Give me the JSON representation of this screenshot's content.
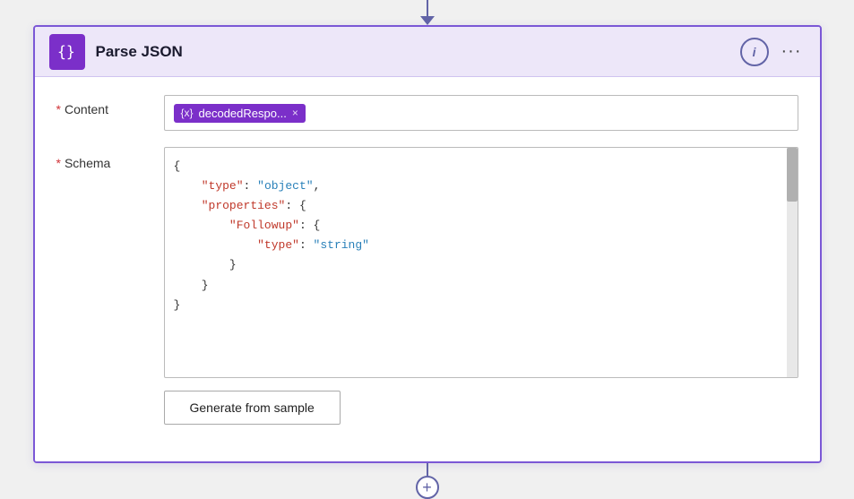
{
  "connector": {
    "top_line_height": "18px",
    "bottom_line_height": "14px"
  },
  "card": {
    "title": "Parse JSON",
    "header_bg": "#ede7f9",
    "border_color": "#7b57d6",
    "icon_name": "braces-icon"
  },
  "info_button": {
    "label": "i"
  },
  "more_button": {
    "label": "···"
  },
  "form": {
    "content_label": "Content",
    "schema_label": "Schema",
    "required_star": "*"
  },
  "token": {
    "name": "decodedRespo...",
    "close": "×"
  },
  "schema_code": {
    "line1": "{",
    "line2": "    \"type\": \"object\",",
    "line3": "    \"properties\": {",
    "line4": "        \"Followup\": {",
    "line5": "            \"type\": \"string\"",
    "line6": "        }",
    "line7": "    }",
    "line8": "}",
    "full_text": "{\n    \"type\": \"object\",\n    \"properties\": {\n        \"Followup\": {\n            \"type\": \"string\"\n        }\n    }\n}"
  },
  "generate_button": {
    "label": "Generate from sample"
  },
  "add_button": {
    "label": "+"
  }
}
